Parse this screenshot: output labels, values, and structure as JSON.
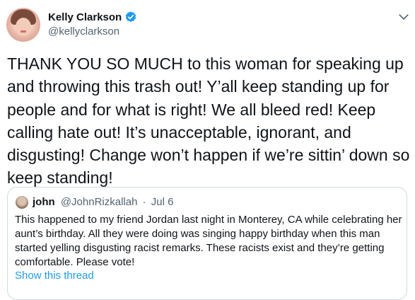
{
  "author": {
    "display_name": "Kelly Clarkson",
    "handle": "@kellyclarkson",
    "verified_icon": "verified-badge-icon"
  },
  "tweet": {
    "text": "THANK YOU SO MUCH to this woman for speaking up and throwing this trash out! Y’all keep standing up for people and for what is right! We all bleed red! Keep calling hate out! It’s unacceptable, ignorant, and disgusting! Change won’t happen if we’re sittin’ down so keep standing!"
  },
  "quoted_tweet": {
    "display_name": "john",
    "handle": "@JohnRizkallah",
    "separator": "·",
    "date": "Jul 6",
    "text": "This happened to my friend Jordan last night in Monterey, CA while celebrating her aunt’s birthday. All they were doing was singing happy birthday when this man started yelling disgusting racist remarks. These racists exist and they’re getting comfortable. Please vote!",
    "show_thread_label": "Show this thread"
  },
  "icons": {
    "more": "chevron-down-icon"
  },
  "colors": {
    "accent": "#1d9bf0",
    "text_primary": "#0f1419",
    "text_secondary": "#536471",
    "border": "#cfd9de"
  }
}
